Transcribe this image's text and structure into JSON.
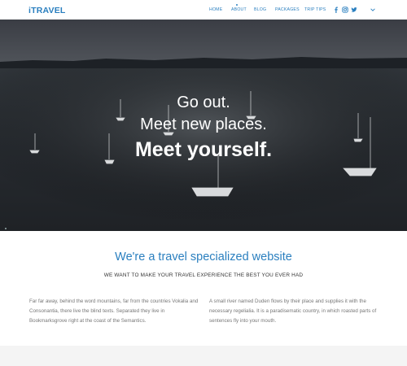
{
  "brand": {
    "logo": "iTRAVEL",
    "accent": "#2a7fbf"
  },
  "nav": {
    "items": [
      {
        "label": "HOME"
      },
      {
        "label": "ABOUT"
      },
      {
        "label": "BLOG"
      },
      {
        "label": "PACKAGES"
      },
      {
        "label": "TRIP TIPS"
      }
    ],
    "social": [
      "facebook-icon",
      "instagram-icon",
      "twitter-icon"
    ],
    "dropdown_icon": "chevron-down-icon"
  },
  "hero": {
    "line1": "Go out.",
    "line2": "Meet new places.",
    "line3": "Meet yourself."
  },
  "intro": {
    "title": "We're a travel specialized website",
    "subtitle": "WE WANT TO MAKE YOUR TRAVEL EXPERIENCE THE BEST YOU EVER HAD",
    "para_left": "Far far away, behind the word mountains, far from the countries Vokalia and Consonantia, there live the blind texts. Separated they live in Bookmarksgrove right at the coast of the Semantics.",
    "para_right": "A small river named Duden flows by their place and supplies it with the necessary regelialia. It is a paradisematic country, in which roasted parts of sentences fly into your mouth."
  }
}
